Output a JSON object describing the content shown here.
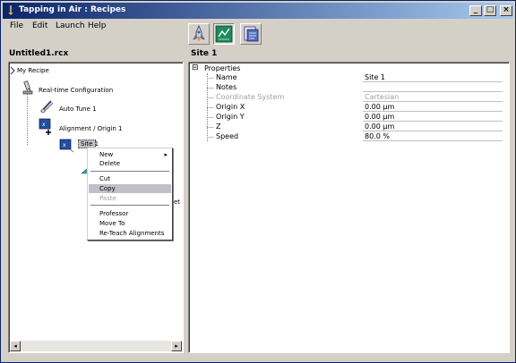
{
  "window": {
    "title": "Tapping in Air : Recipes",
    "minimize": "_",
    "maximize": "□",
    "close": "×"
  },
  "menu": {
    "file": "File",
    "edit": "Edit",
    "launch": "Launch",
    "help": "Help"
  },
  "toolbar": {
    "icons": [
      "rocket-icon",
      "chart-check-icon",
      "document-icon"
    ]
  },
  "left_panel": {
    "file_name": "Untitled1.rcx",
    "tree": {
      "root": "My Recipe",
      "realtime": "Real-time Configuration",
      "autotune": "Auto Tune 1",
      "alignment": "Alignment / Origin 1",
      "site": "Site 1",
      "truncated_suffix": "et"
    }
  },
  "context_menu": {
    "items": {
      "new": "New",
      "delete": "Delete",
      "cut": "Cut",
      "copy": "Copy",
      "paste": "Paste",
      "professor": "Professor",
      "move_to": "Move To",
      "reteach": "Re-Teach Alignments"
    },
    "submenu_arrow": "▸",
    "highlighted": "Copy"
  },
  "right_panel": {
    "header": "Site 1",
    "group_label": "Properties",
    "collapse_glyph": "⊟",
    "properties": [
      {
        "label": "Name",
        "value": "Site 1",
        "enabled": true
      },
      {
        "label": "Notes",
        "value": "",
        "enabled": true
      },
      {
        "label": "Coordinate System",
        "value": "Cartesian",
        "enabled": false
      },
      {
        "label": "Origin X",
        "value": "0.00 µm",
        "enabled": true
      },
      {
        "label": "Origin Y",
        "value": "0.00 µm",
        "enabled": true
      },
      {
        "label": "Z",
        "value": "0.00 µm",
        "enabled": true
      },
      {
        "label": "Speed",
        "value": "80.0 %",
        "enabled": true
      }
    ]
  },
  "scrollbar": {
    "left_arrow": "◂",
    "right_arrow": "▸"
  }
}
